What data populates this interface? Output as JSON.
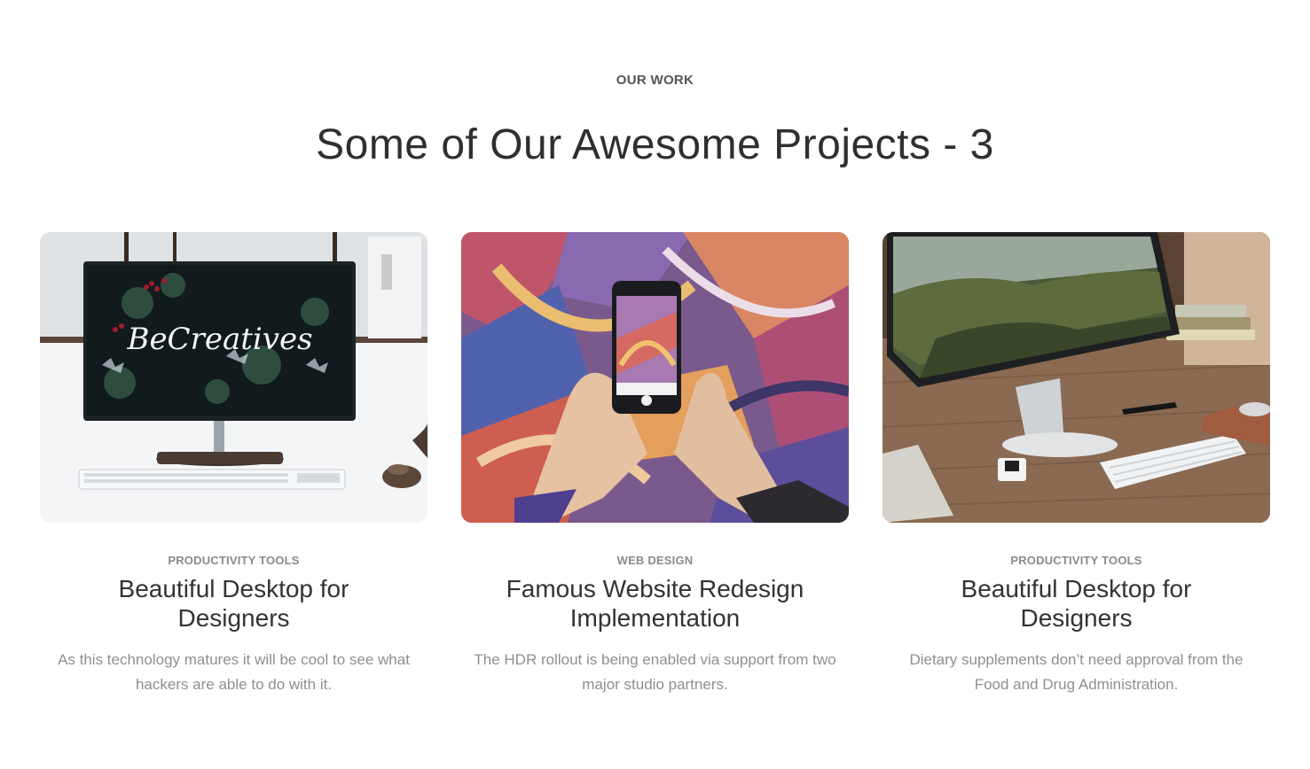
{
  "section": {
    "eyebrow": "OUR WORK",
    "heading": "Some of Our Awesome Projects - 3"
  },
  "projects": [
    {
      "category": "PRODUCTIVITY TOOLS",
      "title": "Beautiful Desktop for Designers",
      "description": "As this technology matures it will be cool to see what hackers are able to do with it.",
      "image_label": "BeCreatives"
    },
    {
      "category": "WEB DESIGN",
      "title": "Famous Website Redesign Implementation",
      "description": "The HDR rollout is being enabled via support from two major studio partners."
    },
    {
      "category": "PRODUCTIVITY TOOLS",
      "title": "Beautiful Desktop for Designers",
      "description": "Dietary supplements don’t need approval from the Food and Drug Administration."
    }
  ]
}
